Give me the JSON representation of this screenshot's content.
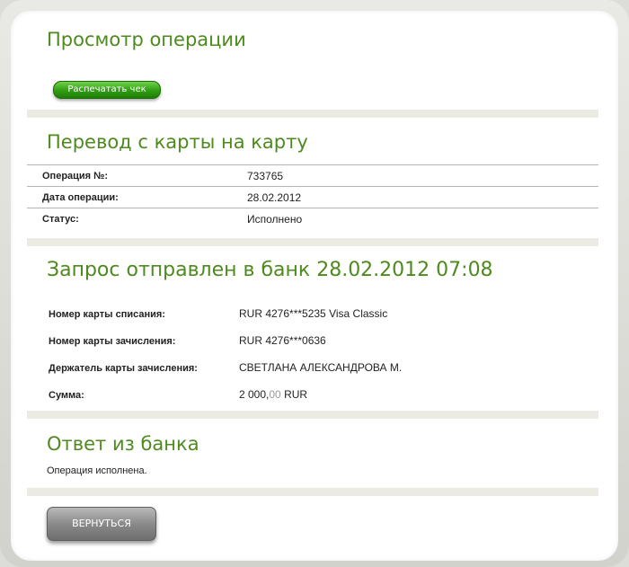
{
  "header": {
    "title": "Просмотр операции",
    "print_button": "Распечатать чек"
  },
  "operation": {
    "title": "Перевод с карты на карту",
    "rows": [
      {
        "label": "Операция №:",
        "value": "733765"
      },
      {
        "label": "Дата операции:",
        "value": "28.02.2012"
      },
      {
        "label": "Статус:",
        "value": "Исполнено"
      }
    ]
  },
  "request": {
    "title": "Запрос отправлен в банк 28.02.2012 07:08",
    "rows": [
      {
        "label": "Номер карты списания:",
        "value": "RUR 4276***5235 Visa Classic"
      },
      {
        "label": "Номер карты зачисления:",
        "value": "RUR 4276***0636"
      },
      {
        "label": "Держатель карты зачисления:",
        "value": "СВЕТЛАНА АЛЕКСАНДРОВА М."
      },
      {
        "label": "Сумма:",
        "amount_main": "2 000,",
        "amount_kop": "00",
        "currency": " RUR"
      }
    ]
  },
  "response": {
    "title": "Ответ из банка",
    "text": "Операция исполнена."
  },
  "footer": {
    "back_button": "ВЕРНУТЬСЯ"
  },
  "colors": {
    "title_green": "#4e8a1e",
    "button_green": "#2f9d12",
    "divider": "#ecebe3",
    "button_grey": "#8a8a8a"
  }
}
